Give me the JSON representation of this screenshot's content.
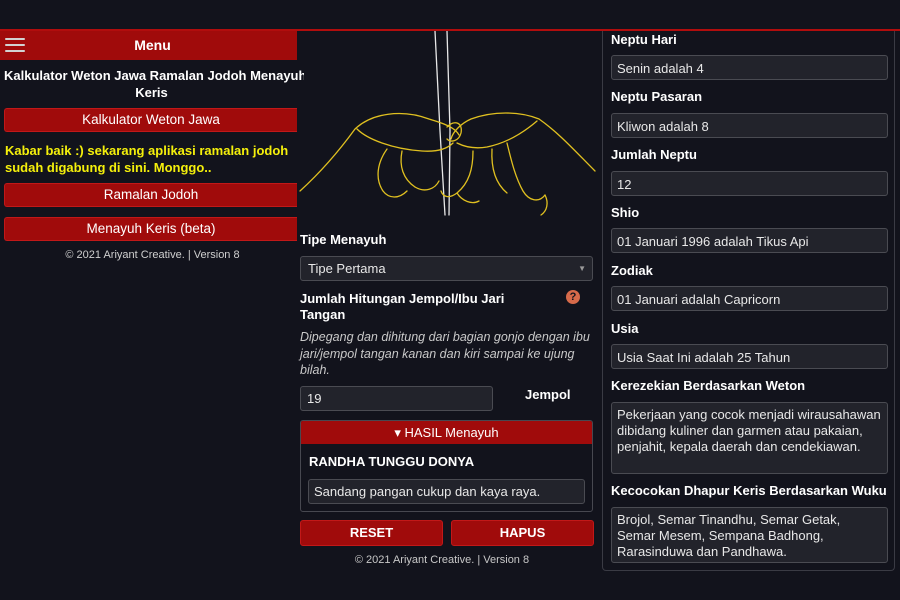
{
  "left": {
    "menu_label": "Menu",
    "title_line1": "Kalkulator Weton Jawa Ramalan Jodoh Menayuh",
    "title_line2": "Keris",
    "btn_weton": "Kalkulator Weton Jawa",
    "note": "Kabar baik :) sekarang aplikasi ramalan jodoh sudah digabung di sini. Monggo..",
    "btn_jodoh": "Ramalan Jodoh",
    "btn_keris": "Menayuh Keris (beta)",
    "copyright": "© 2021 Ariyant Creative. | Version 8"
  },
  "middle": {
    "tipe_label": "Tipe Menayuh",
    "tipe_value": "Tipe Pertama",
    "jumlah_label": "Jumlah Hitungan Jempol/Ibu Jari Tangan",
    "help_icon": "?",
    "description": "Dipegang dan dihitung dari bagian gonjo dengan ibu jari/jempol tangan kanan dan kiri sampai ke ujung bilah.",
    "jempol_value": "19",
    "jempol_unit": "Jempol",
    "result_header": "▾ HASIL Menayuh",
    "result_title": "RANDHA TUNGGU DONYA",
    "result_text": "Sandang pangan cukup dan kaya raya.",
    "btn_reset": "RESET",
    "btn_hapus": "HAPUS",
    "copyright": "© 2021 Ariyant Creative. | Version 8"
  },
  "right": {
    "fields": [
      {
        "label": "Neptu Hari",
        "value": "Senin adalah 4"
      },
      {
        "label": "Neptu Pasaran",
        "value": "Kliwon adalah 8"
      },
      {
        "label": "Jumlah Neptu",
        "value": "12"
      },
      {
        "label": "Shio",
        "value": "01 Januari 1996 adalah Tikus Api"
      },
      {
        "label": "Zodiak",
        "value": "01 Januari adalah Capricorn"
      },
      {
        "label": "Usia",
        "value": "Usia Saat Ini adalah 25 Tahun"
      },
      {
        "label": "Kerezekian Berdasarkan Weton",
        "value": "Pekerjaan yang cocok menjadi wirausahawan dibidang kuliner dan garmen atau pakaian, penjahit, kepala daerah dan cendekiawan."
      },
      {
        "label": "Kecocokan Dhapur Keris Berdasarkan Wuku",
        "value": "Brojol, Semar Tinandhu, Semar Getak, Semar Mesem, Sempana Badhong, Rarasinduwa dan Pandhawa."
      }
    ]
  },
  "colors": {
    "background": "#12131c",
    "accent_red": "#a00b0b",
    "note_yellow": "#f5f00b",
    "field_bg": "#22232b",
    "illustration_line": "#e0c020"
  }
}
